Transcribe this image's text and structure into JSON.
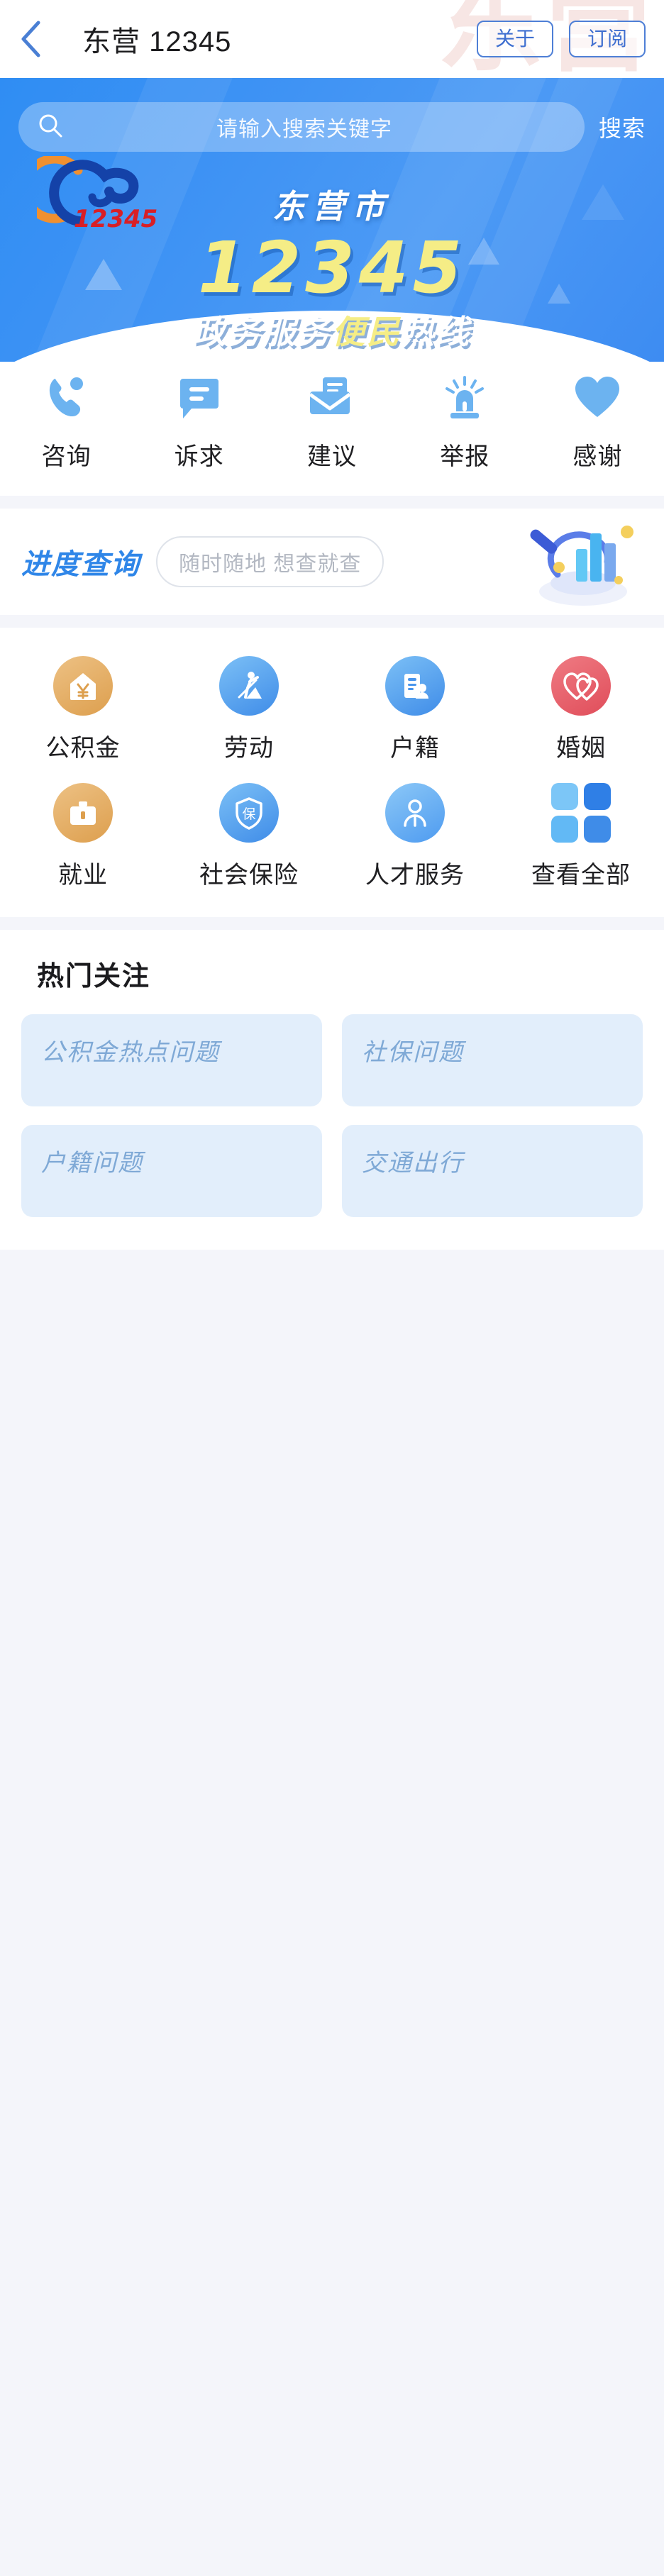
{
  "header": {
    "back_icon": "chevron-left-icon",
    "title": "东营 12345",
    "about_label": "关于",
    "subscribe_label": "订阅",
    "watermark": "东营"
  },
  "search": {
    "icon": "search-icon",
    "placeholder": "请输入搜索关键字",
    "button_label": "搜索"
  },
  "banner": {
    "logo_text": "12345",
    "city": "东营市",
    "number": "12345",
    "slogan_white_1": "政务服务",
    "slogan_yellow": "便民",
    "slogan_white_2": "热线"
  },
  "quick_actions": [
    {
      "label": "咨询",
      "icon": "phone-icon"
    },
    {
      "label": "诉求",
      "icon": "message-bubble-icon"
    },
    {
      "label": "建议",
      "icon": "envelope-icon"
    },
    {
      "label": "举报",
      "icon": "alarm-siren-icon"
    },
    {
      "label": "感谢",
      "icon": "heart-icon"
    }
  ],
  "progress": {
    "title": "进度查询",
    "pill_text": "随时随地 想查就查",
    "art_icon": "magnifier-bar-chart-illustration"
  },
  "services": {
    "row1": [
      {
        "label": "公积金",
        "icon": "house-yuan-icon",
        "color": "#e3ad65"
      },
      {
        "label": "劳动",
        "icon": "worker-icon",
        "color": "#55a0ef"
      },
      {
        "label": "户籍",
        "icon": "document-person-icon",
        "color": "#55a0ef"
      },
      {
        "label": "婚姻",
        "icon": "double-heart-icon",
        "color": "#e8636d"
      }
    ],
    "row2": [
      {
        "label": "就业",
        "icon": "briefcase-icon",
        "color": "#e3ad65"
      },
      {
        "label": "社会保险",
        "icon": "shield-bao-icon",
        "color": "#55a0ef"
      },
      {
        "label": "人才服务",
        "icon": "person-icon",
        "color": "#6fb0f2"
      },
      {
        "label": "查看全部",
        "icon": "grid-four-icon",
        "color": "#4f9bf0"
      }
    ]
  },
  "hot": {
    "title": "热门关注",
    "cards": [
      {
        "label": "公积金热点问题"
      },
      {
        "label": "社保问题"
      },
      {
        "label": "户籍问题"
      },
      {
        "label": "交通出行"
      }
    ]
  },
  "colors": {
    "accent_blue": "#3f93f4",
    "icon_blue": "#6cb3f0",
    "hot_card_bg": "#e2eefb",
    "hot_card_text": "#7fa9d6",
    "banner_yellow": "#f5ed86"
  }
}
